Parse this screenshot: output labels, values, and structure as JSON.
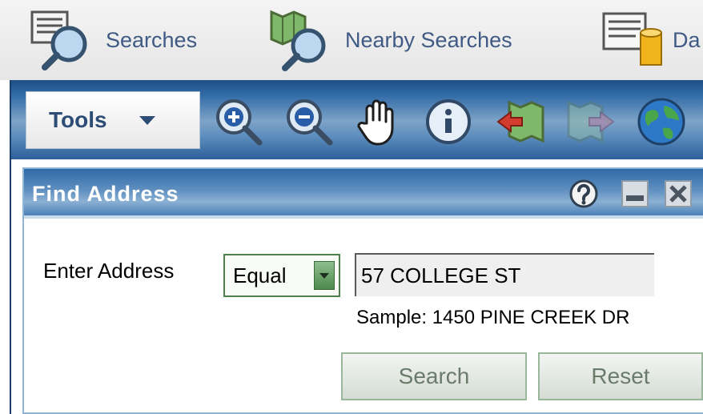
{
  "top_tabs": [
    {
      "label": "Searches",
      "icon": "magnifier-document-icon"
    },
    {
      "label": "Nearby Searches",
      "icon": "map-magnifier-icon"
    },
    {
      "label": "Da",
      "icon": "database-icon"
    }
  ],
  "toolbar": {
    "tools_label": "Tools",
    "icons": [
      "zoom-in-icon",
      "zoom-out-icon",
      "pan-hand-icon",
      "identify-info-icon",
      "previous-extent-icon",
      "next-extent-icon",
      "full-extent-globe-icon"
    ]
  },
  "panel": {
    "title": "Find Address",
    "header_icons": [
      "help-icon",
      "minimize-icon",
      "close-icon"
    ],
    "address_label": "Enter Address",
    "match_select": {
      "selected": "Equal"
    },
    "address_value": "57 COLLEGE ST",
    "sample_text": "Sample: 1450 PINE CREEK DR",
    "search_label": "Search",
    "reset_label": "Reset"
  },
  "colors": {
    "toolbar_blue": "#2f6aa6",
    "tab_text": "#3f5a84",
    "button_border_green": "#99b79a"
  }
}
